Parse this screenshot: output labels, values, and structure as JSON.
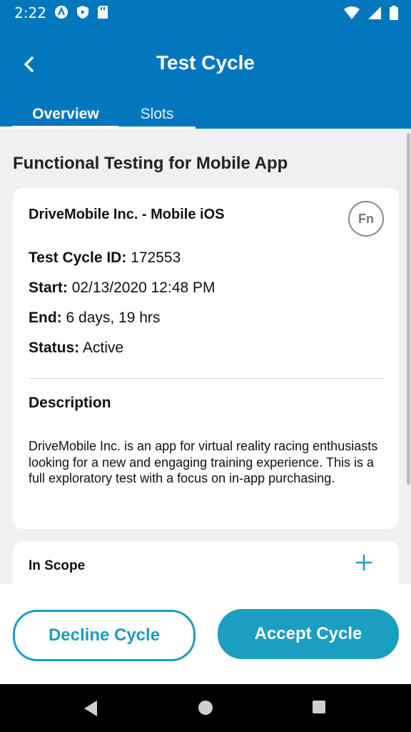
{
  "status_bar": {
    "time": "2:22"
  },
  "header": {
    "title": "Test Cycle",
    "tabs": [
      "Overview",
      "Slots"
    ]
  },
  "page_heading": "Functional Testing for Mobile App",
  "cycle": {
    "company": "DriveMobile Inc. - Mobile iOS",
    "badge": "Fn",
    "id_label": "Test Cycle ID:",
    "id_value": "172553",
    "start_label": "Start:",
    "start_value": "02/13/2020 12:48 PM",
    "end_label": "End:",
    "end_value": "6 days, 19 hrs",
    "status_label": "Status:",
    "status_value": "Active",
    "description_heading": "Description",
    "description": "DriveMobile Inc. is an app for virtual reality racing enthusiasts looking for a new and engaging training experience. This is a full exploratory test with a focus on in-app purchasing."
  },
  "scope": {
    "label": "In Scope"
  },
  "actions": {
    "decline": "Decline Cycle",
    "accept": "Accept Cycle"
  },
  "colors": {
    "primary": "#0277bd",
    "accent": "#1a9ec1"
  },
  "icons": [
    "back-arrow-icon",
    "plus-icon",
    "wifi-icon",
    "signal-icon",
    "battery-icon",
    "nav-back-icon",
    "nav-home-icon",
    "nav-recents-icon"
  ]
}
